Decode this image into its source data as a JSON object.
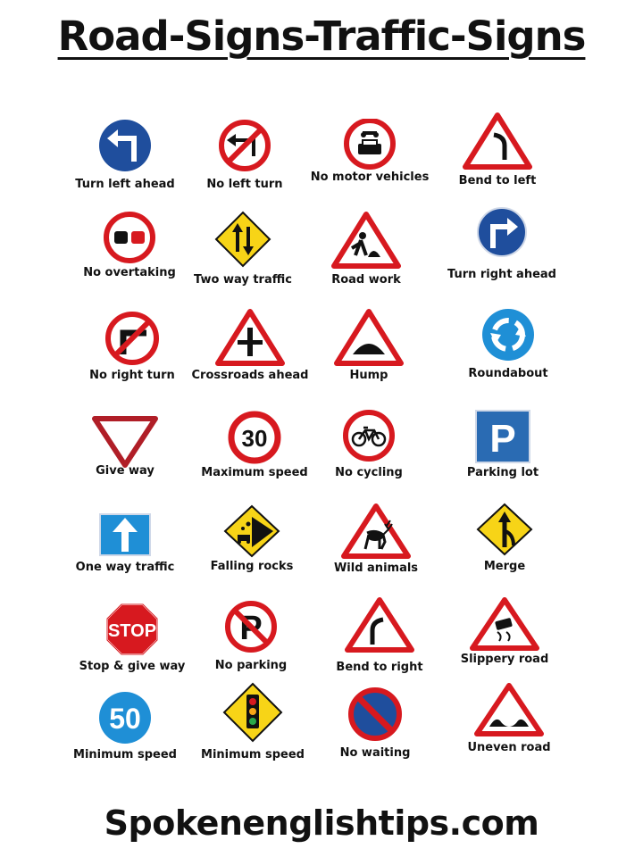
{
  "title": "Road-Signs-Traffic-Signs",
  "footer": "Spokenenglishtips.com",
  "colors": {
    "red": "#d7191f",
    "blue": "#1f4e9d",
    "yellow": "#f7d417",
    "black": "#111111"
  },
  "signs": [
    {
      "label": "Turn left ahead",
      "icon": "turn-left-ahead-icon"
    },
    {
      "label": "No left turn",
      "icon": "no-left-turn-icon"
    },
    {
      "label": "No motor vehicles",
      "icon": "no-motor-vehicles-icon"
    },
    {
      "label": "Bend to left",
      "icon": "bend-left-icon"
    },
    {
      "label": "No overtaking",
      "icon": "no-overtaking-icon"
    },
    {
      "label": "Two way traffic",
      "icon": "two-way-traffic-icon"
    },
    {
      "label": "Road work",
      "icon": "road-work-icon"
    },
    {
      "label": "Turn right ahead",
      "icon": "turn-right-ahead-icon"
    },
    {
      "label": "No right turn",
      "icon": "no-right-turn-icon"
    },
    {
      "label": "Crossroads ahead",
      "icon": "crossroads-icon"
    },
    {
      "label": "Hump",
      "icon": "hump-icon"
    },
    {
      "label": "Roundabout",
      "icon": "roundabout-icon"
    },
    {
      "label": "Give way",
      "icon": "give-way-icon"
    },
    {
      "label": "Maximum speed",
      "icon": "maximum-speed-icon",
      "value": "30"
    },
    {
      "label": "No cycling",
      "icon": "no-cycling-icon"
    },
    {
      "label": "Parking lot",
      "icon": "parking-icon",
      "value": "P"
    },
    {
      "label": "One way traffic",
      "icon": "one-way-icon"
    },
    {
      "label": "Falling rocks",
      "icon": "falling-rocks-icon"
    },
    {
      "label": "Wild animals",
      "icon": "wild-animals-icon"
    },
    {
      "label": "Merge",
      "icon": "merge-icon"
    },
    {
      "label": "Stop & give way",
      "icon": "stop-icon",
      "value": "STOP"
    },
    {
      "label": "No parking",
      "icon": "no-parking-icon",
      "value": "P"
    },
    {
      "label": "Bend to right",
      "icon": "bend-right-icon"
    },
    {
      "label": "Slippery road",
      "icon": "slippery-road-icon"
    },
    {
      "label": "Minimum speed",
      "icon": "minimum-speed-icon",
      "value": "50"
    },
    {
      "label": "Minimum speed",
      "icon": "traffic-light-icon"
    },
    {
      "label": "No waiting",
      "icon": "no-waiting-icon"
    },
    {
      "label": "Uneven road",
      "icon": "uneven-road-icon"
    }
  ]
}
